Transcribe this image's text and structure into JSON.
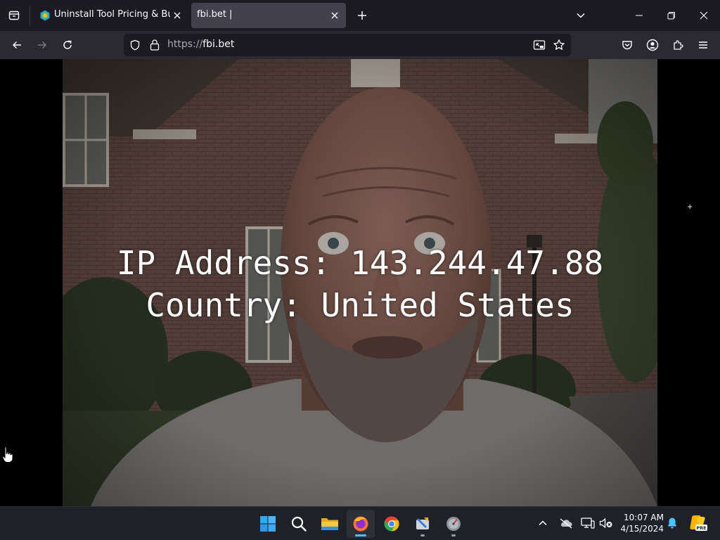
{
  "browser": {
    "tabs": [
      {
        "title": "Uninstall Tool Pricing & Buy",
        "active": false,
        "favicon": "uninstall-tool-logo-icon"
      },
      {
        "title": "fbi.bet |",
        "active": true,
        "favicon": "none"
      }
    ],
    "url": {
      "scheme": "https://",
      "host": "fbi.bet"
    }
  },
  "page": {
    "ip_line": "IP Address: 143.244.47.88",
    "country_line": "Country: United States",
    "stray_glyph": "+"
  },
  "taskbar": {
    "apps": [
      {
        "name": "start-button",
        "icon": "windows-logo-icon"
      },
      {
        "name": "search-button",
        "icon": "search-icon"
      },
      {
        "name": "file-explorer",
        "icon": "folder-icon"
      },
      {
        "name": "firefox",
        "icon": "firefox-icon",
        "active": true
      },
      {
        "name": "chrome",
        "icon": "chrome-icon"
      },
      {
        "name": "app-tool",
        "icon": "tool-app-icon"
      },
      {
        "name": "app-disk",
        "icon": "disk-app-icon"
      }
    ],
    "time": "10:07 AM",
    "date": "4/15/2024",
    "tray_badge": "PRE"
  },
  "colors": {
    "tabbar_bg": "#1c1b22",
    "toolbar_bg": "#2b2a33",
    "active_tab_bg": "#42414d",
    "accent": "#4cc2ff"
  }
}
